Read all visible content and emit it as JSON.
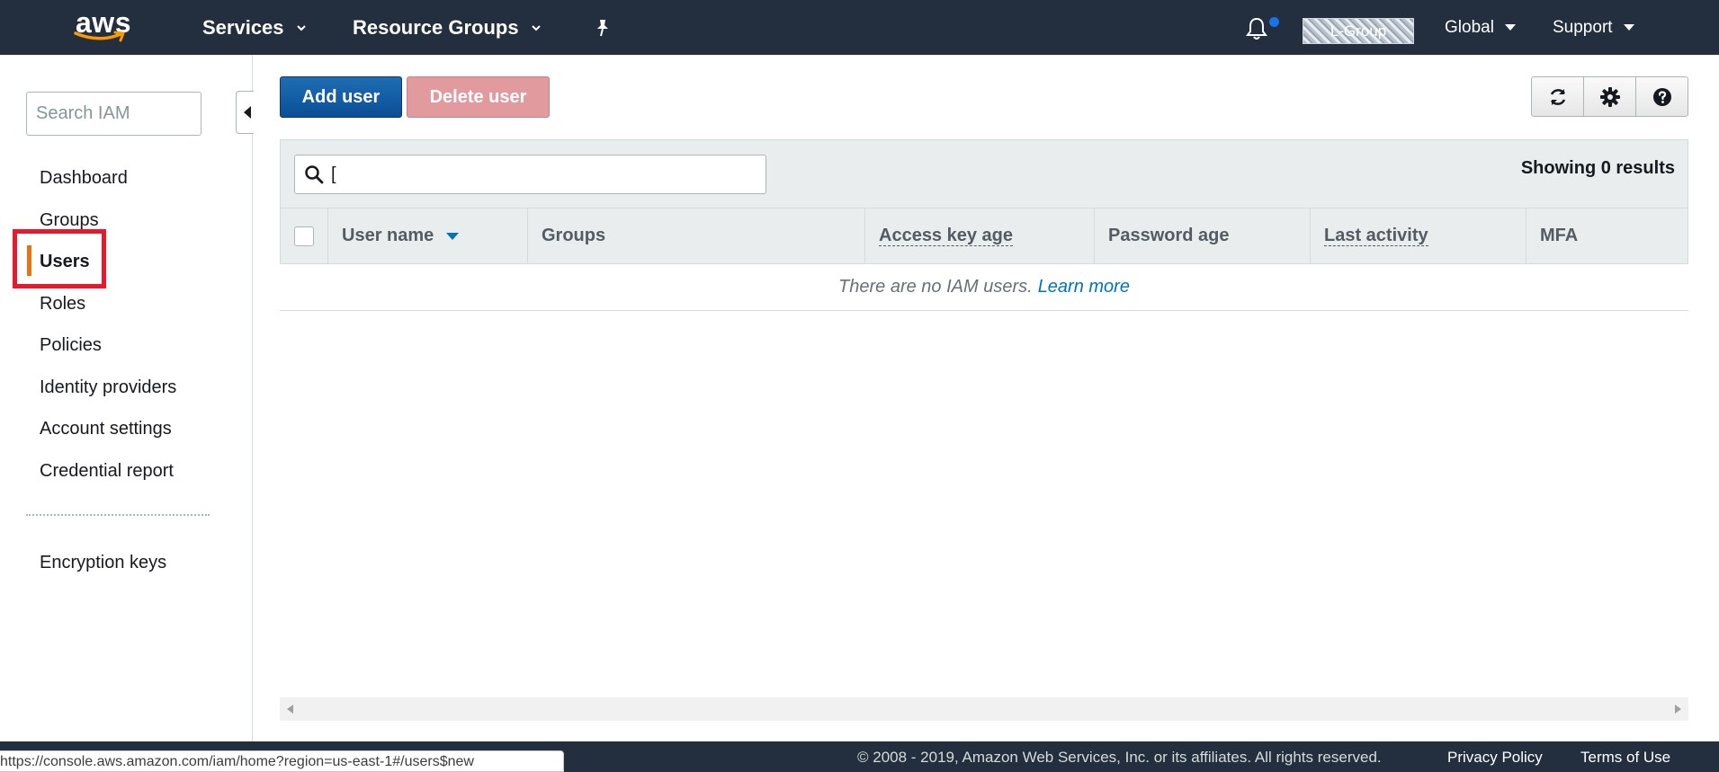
{
  "nav": {
    "logo_text": "aws",
    "services": "Services",
    "resource_groups": "Resource Groups",
    "account_label": "L-Group",
    "region": "Global",
    "support": "Support"
  },
  "sidebar": {
    "search_placeholder": "Search IAM",
    "items": [
      {
        "label": "Dashboard"
      },
      {
        "label": "Groups"
      },
      {
        "label": "Users"
      },
      {
        "label": "Roles"
      },
      {
        "label": "Policies"
      },
      {
        "label": "Identity providers"
      },
      {
        "label": "Account settings"
      },
      {
        "label": "Credential report"
      }
    ],
    "active_item": "Users",
    "secondary_items": [
      {
        "label": "Encryption keys"
      }
    ]
  },
  "toolbar": {
    "add_user": "Add user",
    "delete_user": "Delete user",
    "icons": [
      "refresh-icon",
      "gear-icon",
      "help-icon"
    ]
  },
  "table": {
    "filter_value": "[",
    "results_text": "Showing 0 results",
    "columns": [
      {
        "label": "User name",
        "sorted": "desc"
      },
      {
        "label": "Groups"
      },
      {
        "label": "Access key age"
      },
      {
        "label": "Password age"
      },
      {
        "label": "Last activity"
      },
      {
        "label": "MFA"
      }
    ],
    "empty_text": "There are no IAM users.",
    "empty_link": "Learn more"
  },
  "footer": {
    "copyright": "© 2008 - 2019, Amazon Web Services, Inc. or its affiliates. All rights reserved.",
    "privacy": "Privacy Policy",
    "terms": "Terms of Use"
  },
  "status_url": "https://console.aws.amazon.com/iam/home?region=us-east-1#/users$new",
  "colors": {
    "nav_bg": "#232f3e",
    "primary_button": "#0a4f96",
    "danger_disabled": "#e19b9e",
    "link": "#0073bb",
    "active_indicator": "#ec7211",
    "highlight": "#e8192c"
  }
}
